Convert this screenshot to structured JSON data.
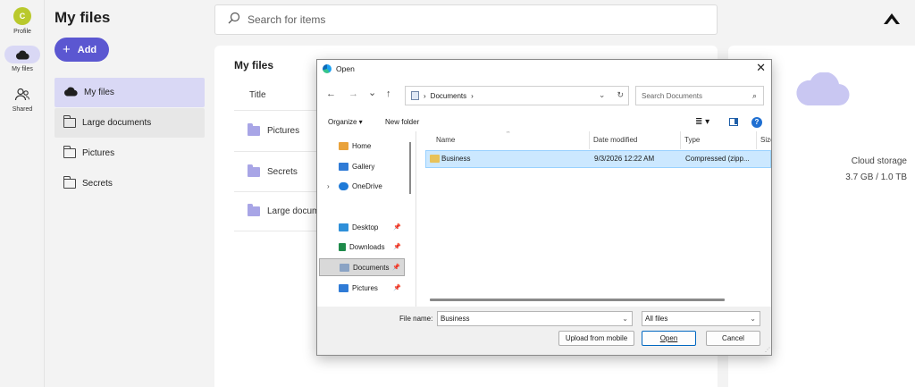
{
  "rail": {
    "profile": {
      "initial": "C",
      "label": "Profile"
    },
    "my_files": {
      "label": "My files"
    },
    "shared": {
      "label": "Shared"
    }
  },
  "page": {
    "title": "My files",
    "add_label": "Add"
  },
  "nav": [
    {
      "label": "My files",
      "icon": "cloud-icon",
      "state": "selected"
    },
    {
      "label": "Large documents",
      "icon": "folder-icon",
      "state": "hover"
    },
    {
      "label": "Pictures",
      "icon": "folder-icon",
      "state": "normal"
    },
    {
      "label": "Secrets",
      "icon": "folder-icon",
      "state": "normal"
    }
  ],
  "search": {
    "placeholder": "Search for items"
  },
  "card": {
    "title": "My files",
    "column_title": "Title",
    "rows": [
      {
        "name": "Pictures"
      },
      {
        "name": "Secrets"
      },
      {
        "name": "Large docum"
      }
    ]
  },
  "storage": {
    "label": "Cloud storage",
    "value": "3.7 GB / 1.0 TB"
  },
  "dialog": {
    "title": "Open",
    "close_glyph": "✕",
    "nav": {
      "back": "←",
      "forward": "→",
      "recent": "⌄",
      "up": "↑"
    },
    "address": {
      "segments": [
        "Documents"
      ],
      "sep": "›"
    },
    "search_placeholder": "Search Documents",
    "toolbar": {
      "organize": "Organize ▾",
      "new_folder": "New folder",
      "help": "?"
    },
    "tree": [
      {
        "label": "Home",
        "icon": "home-icon",
        "color": "#e9a23b"
      },
      {
        "label": "Gallery",
        "icon": "gallery-icon",
        "color": "#2f7bd6"
      },
      {
        "label": "OneDrive",
        "icon": "onedrive-icon",
        "color": "#1f7ad8",
        "expandable": true
      },
      {
        "label": "Desktop",
        "icon": "desktop-icon",
        "color": "#2e8fd9",
        "pinned": true
      },
      {
        "label": "Downloads",
        "icon": "downloads-icon",
        "color": "#1e8a4a",
        "pinned": true
      },
      {
        "label": "Documents",
        "icon": "documents-icon",
        "color": "#8aa3c4",
        "pinned": true,
        "selected": true
      },
      {
        "label": "Pictures",
        "icon": "pictures-icon",
        "color": "#2f7bd6",
        "pinned": true
      }
    ],
    "columns": [
      "Name",
      "Date modified",
      "Type",
      "Size"
    ],
    "files": [
      {
        "name": "Business",
        "date": "9/3/2026 12:22 AM",
        "type": "Compressed (zipp...",
        "selected": true
      }
    ],
    "file_name_label": "File name:",
    "file_name_value": "Business",
    "filter": "All files",
    "buttons": {
      "upload": "Upload from mobile",
      "open": "Open",
      "cancel": "Cancel"
    }
  },
  "colors": {
    "accent": "#5b57d1",
    "selected_nav": "#d9d8f5",
    "folder": "#a8a5e6",
    "dialog_select": "#cce8ff"
  }
}
